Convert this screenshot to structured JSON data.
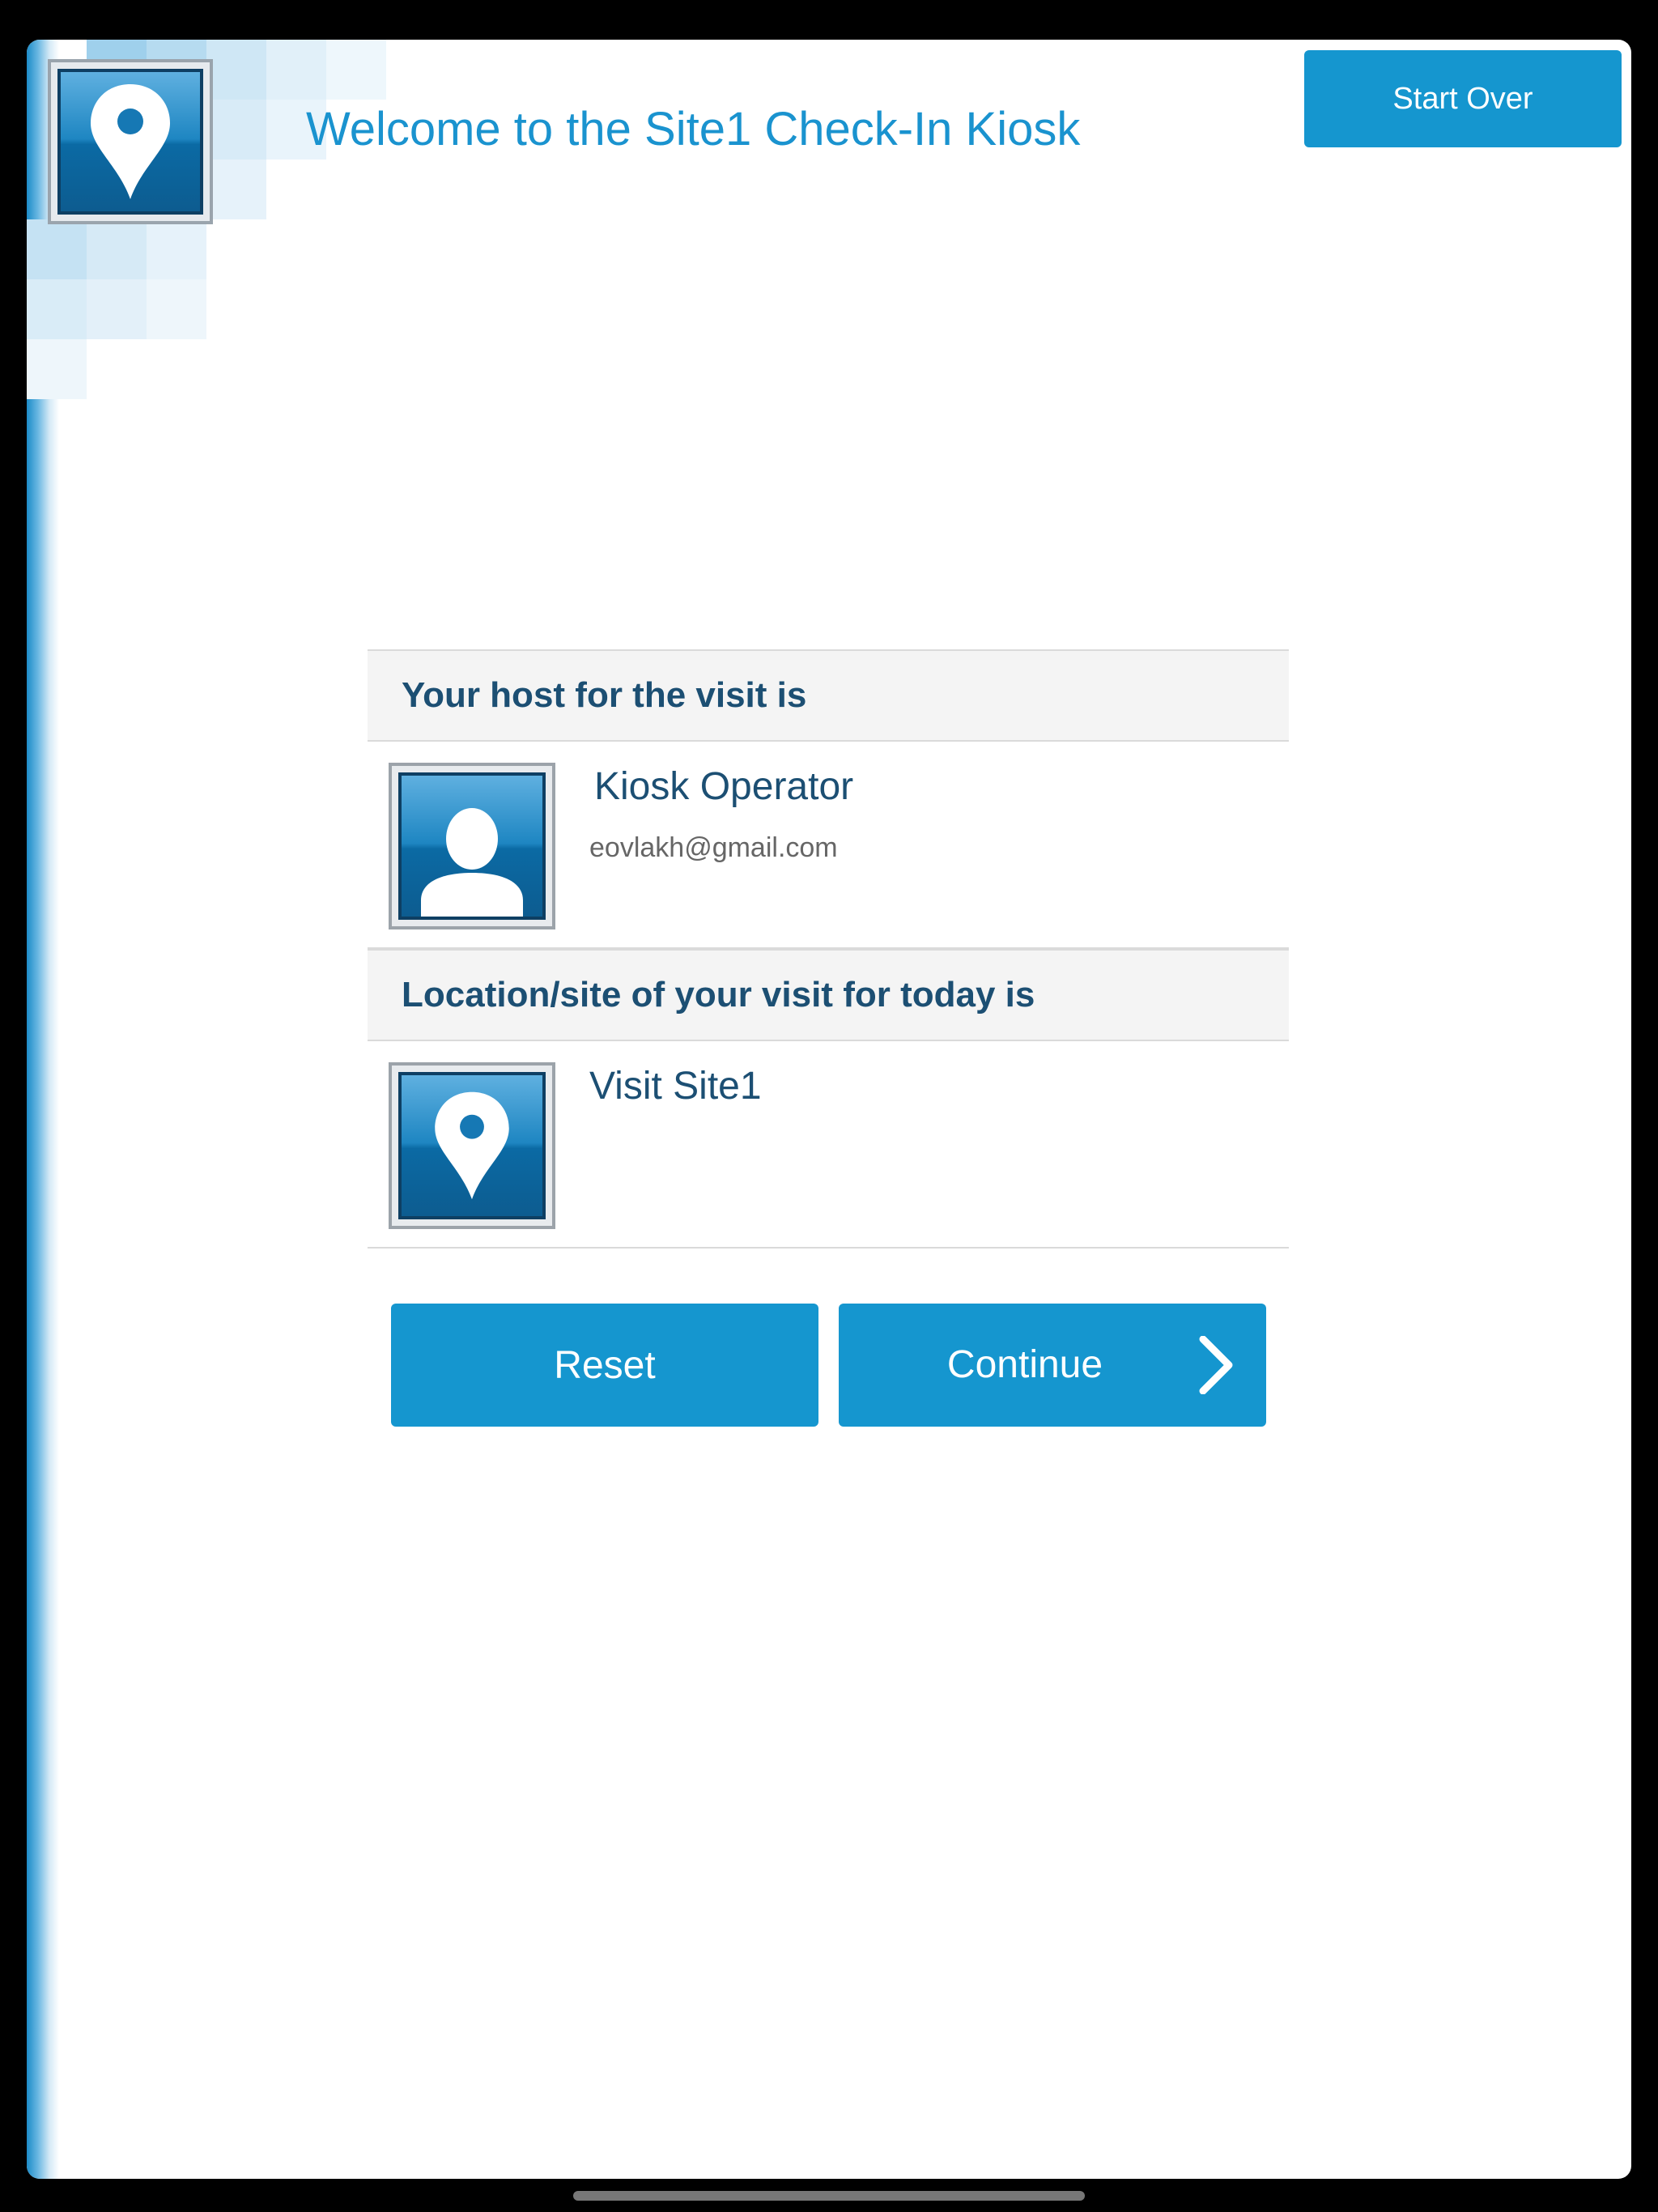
{
  "header": {
    "title": "Welcome to the Site1 Check-In Kiosk",
    "start_over_label": "Start Over",
    "logo_icon": "location-pin-icon"
  },
  "host_section": {
    "heading": "Your host for the visit is",
    "name": "Kiosk Operator",
    "email": "eovlakh@gmail.com",
    "avatar_icon": "person-icon"
  },
  "location_section": {
    "heading": "Location/site of your visit for today is",
    "site_name": "Visit Site1",
    "icon": "location-pin-icon"
  },
  "actions": {
    "reset_label": "Reset",
    "continue_label": "Continue"
  },
  "colors": {
    "accent": "#1596cf",
    "heading_text": "#1c4f73",
    "title_text": "#1a93cf"
  }
}
